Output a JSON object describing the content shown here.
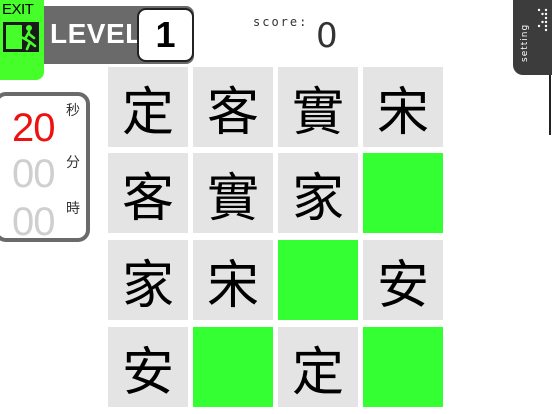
{
  "exit": {
    "label": "EXIT"
  },
  "level": {
    "label": "LEVEL",
    "value": "1"
  },
  "score": {
    "label": "score:",
    "value": "0"
  },
  "setting": {
    "label": "setting"
  },
  "timer": {
    "seconds": "20",
    "seconds_unit": "秒",
    "minutes": "00",
    "minutes_unit": "分",
    "hours": "00",
    "hours_unit": "時"
  },
  "colors": {
    "cleared": "#33ff33",
    "tile": "#e4e4e4",
    "accent": "#46ff2a",
    "timer_active": "#ee1111"
  },
  "board": {
    "rows": [
      [
        {
          "char": "定",
          "cleared": false
        },
        {
          "char": "客",
          "cleared": false
        },
        {
          "char": "實",
          "cleared": false
        },
        {
          "char": "宋",
          "cleared": false
        }
      ],
      [
        {
          "char": "客",
          "cleared": false
        },
        {
          "char": "實",
          "cleared": false
        },
        {
          "char": "家",
          "cleared": false
        },
        {
          "char": "",
          "cleared": true
        }
      ],
      [
        {
          "char": "家",
          "cleared": false
        },
        {
          "char": "宋",
          "cleared": false
        },
        {
          "char": "",
          "cleared": true
        },
        {
          "char": "安",
          "cleared": false
        }
      ],
      [
        {
          "char": "安",
          "cleared": false
        },
        {
          "char": "",
          "cleared": true
        },
        {
          "char": "定",
          "cleared": false
        },
        {
          "char": "",
          "cleared": true
        }
      ]
    ]
  }
}
